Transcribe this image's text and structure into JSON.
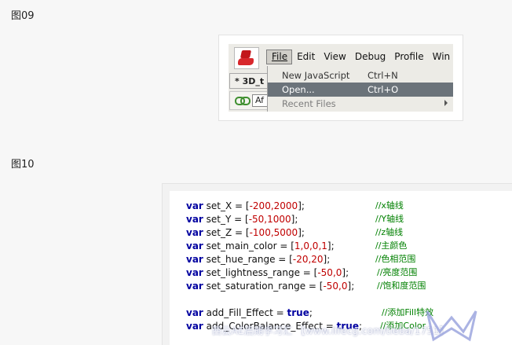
{
  "figure09": {
    "label": "图09",
    "menu": [
      "File",
      "Edit",
      "View",
      "Debug",
      "Profile",
      "Win"
    ],
    "doc_tab": "* 3D_t",
    "field_text": "Af",
    "dropdown": [
      {
        "label": "New JavaScript",
        "shortcut": "Ctrl+N",
        "state": "normal"
      },
      {
        "label": "Open...",
        "shortcut": "Ctrl+O",
        "state": "selected"
      },
      {
        "label": "Recent Files",
        "shortcut": "",
        "state": "submenu"
      }
    ]
  },
  "figure10": {
    "label": "图10",
    "code": [
      {
        "kw": "var",
        "rest": " set_X = [",
        "v": "-200,2000",
        "end": "];",
        "comment": "//x轴线"
      },
      {
        "kw": "var",
        "rest": " set_Y = [",
        "v": "-50,1000",
        "end": "];",
        "comment": "//Y轴线"
      },
      {
        "kw": "var",
        "rest": " set_Z = [",
        "v": "-100,5000",
        "end": "];",
        "comment": "//z轴线"
      },
      {
        "kw": "var",
        "rest": " set_main_color = [",
        "v": "1,0,0,1",
        "end": "];",
        "comment": "//主颜色"
      },
      {
        "kw": "var",
        "rest": " set_hue_range = [",
        "v": "-20,20",
        "end": "];",
        "comment": "//色相范围"
      },
      {
        "kw": "var",
        "rest": " set_lightness_range = [",
        "v": "-50,0",
        "end": "];",
        "comment": "//亮度范围"
      },
      {
        "kw": "var",
        "rest": " set_saturation_range = [",
        "v": "-50,0",
        "end": "];",
        "comment": "//饱和度范围"
      },
      {
        "kw": "var",
        "rest": " add_Fill_Effect = ",
        "v": "true",
        "end": ";",
        "comment": "//添加Fill特效"
      },
      {
        "kw": "var",
        "rest": " add_ColorBalance_Effect = ",
        "v": "true",
        "end": ";",
        "comment": "//添加Color"
      }
    ]
  },
  "watermark": "西云AE后期学习汇 【www.lifecg.com/tieba/1751】"
}
